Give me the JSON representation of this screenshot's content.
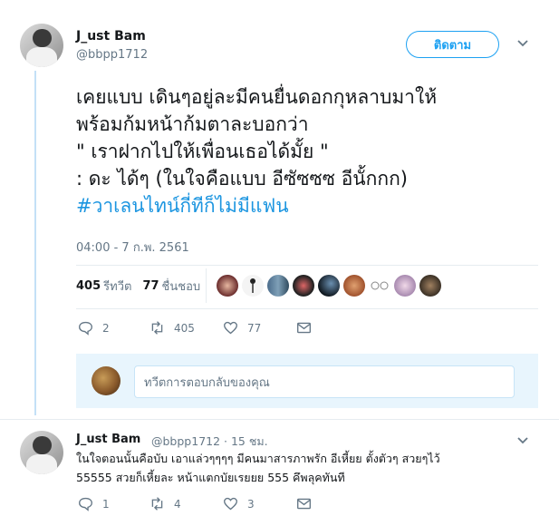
{
  "tweet": {
    "author_name": "J_ust Bam",
    "author_handle": "@bbpp1712",
    "follow_label": "ติดตาม",
    "text": "เคยแบบ เดินๆอยู่ละมีคนยื่นดอกกุหลาบมาให้\nพร้อมก้มหน้าก้มตาละบอกว่า\n\" เราฝากไปให้เพื่อนเธอได้มั้ย \"\n: ดะ  ได้ๆ   (ในใจคือแบบ อีซัซซซ อีนั้กกก)",
    "hashtag": "#วาเลนไทน์กี่ทีก็ไม่มีแฟน",
    "timestamp": "04:00 - 7 ก.พ. 2561",
    "retweets_count": "405",
    "retweets_label": "รีทวีต",
    "likes_count": "77",
    "likes_label": "ชื่นชอบ",
    "actions": {
      "reply_count": "2",
      "retweet_count": "405",
      "like_count": "77"
    }
  },
  "reply_composer": {
    "placeholder": "ทวีตการตอบกลับของคุณ"
  },
  "reply": {
    "author_name": "J_ust Bam",
    "author_handle": "@bbpp1712 · 15 ชม.",
    "text": "ในใจตอนนั้นคือบับ  เอาแล่วๆๆๆๆ มีคนมาสารภาพรัก อีเหี้ยย ตั้งตัวๆ สวยๆไว้\n55555 สวยก็เหี้ยละ หน้าแตกบัยเรยยย 555 คึพลุคทันที",
    "actions": {
      "reply_count": "1",
      "retweet_count": "4",
      "like_count": "3"
    }
  },
  "colors": {
    "accent": "#1da1f2",
    "hashtag": "#1b95e0",
    "muted": "#657786",
    "thread_line": "#c4e0f7"
  }
}
